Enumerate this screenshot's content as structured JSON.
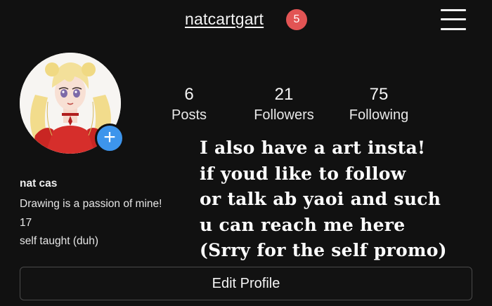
{
  "header": {
    "username": "natcartgart",
    "notification_count": "5",
    "menu_icon": "hamburger-menu-icon"
  },
  "profile": {
    "avatar_icon": "avatar",
    "add_story_label": "+",
    "stats": [
      {
        "value": "6",
        "label": "Posts"
      },
      {
        "value": "21",
        "label": "Followers"
      },
      {
        "value": "75",
        "label": "Following"
      }
    ],
    "bio": {
      "name": "nat cas",
      "lines": [
        "Drawing is a passion of mine!",
        "17",
        "self taught (duh)"
      ]
    },
    "edit_button_label": "Edit Profile"
  },
  "overlay_caption": {
    "lines": [
      "I also have a art insta!",
      "if youd like to follow",
      "or talk ab yaoi and such",
      "u can reach me here",
      "(Srry for the self promo)"
    ],
    "color": "#ffffff"
  },
  "colors": {
    "background": "#111111",
    "badge": "#e25454",
    "add_story": "#3d95ec"
  }
}
